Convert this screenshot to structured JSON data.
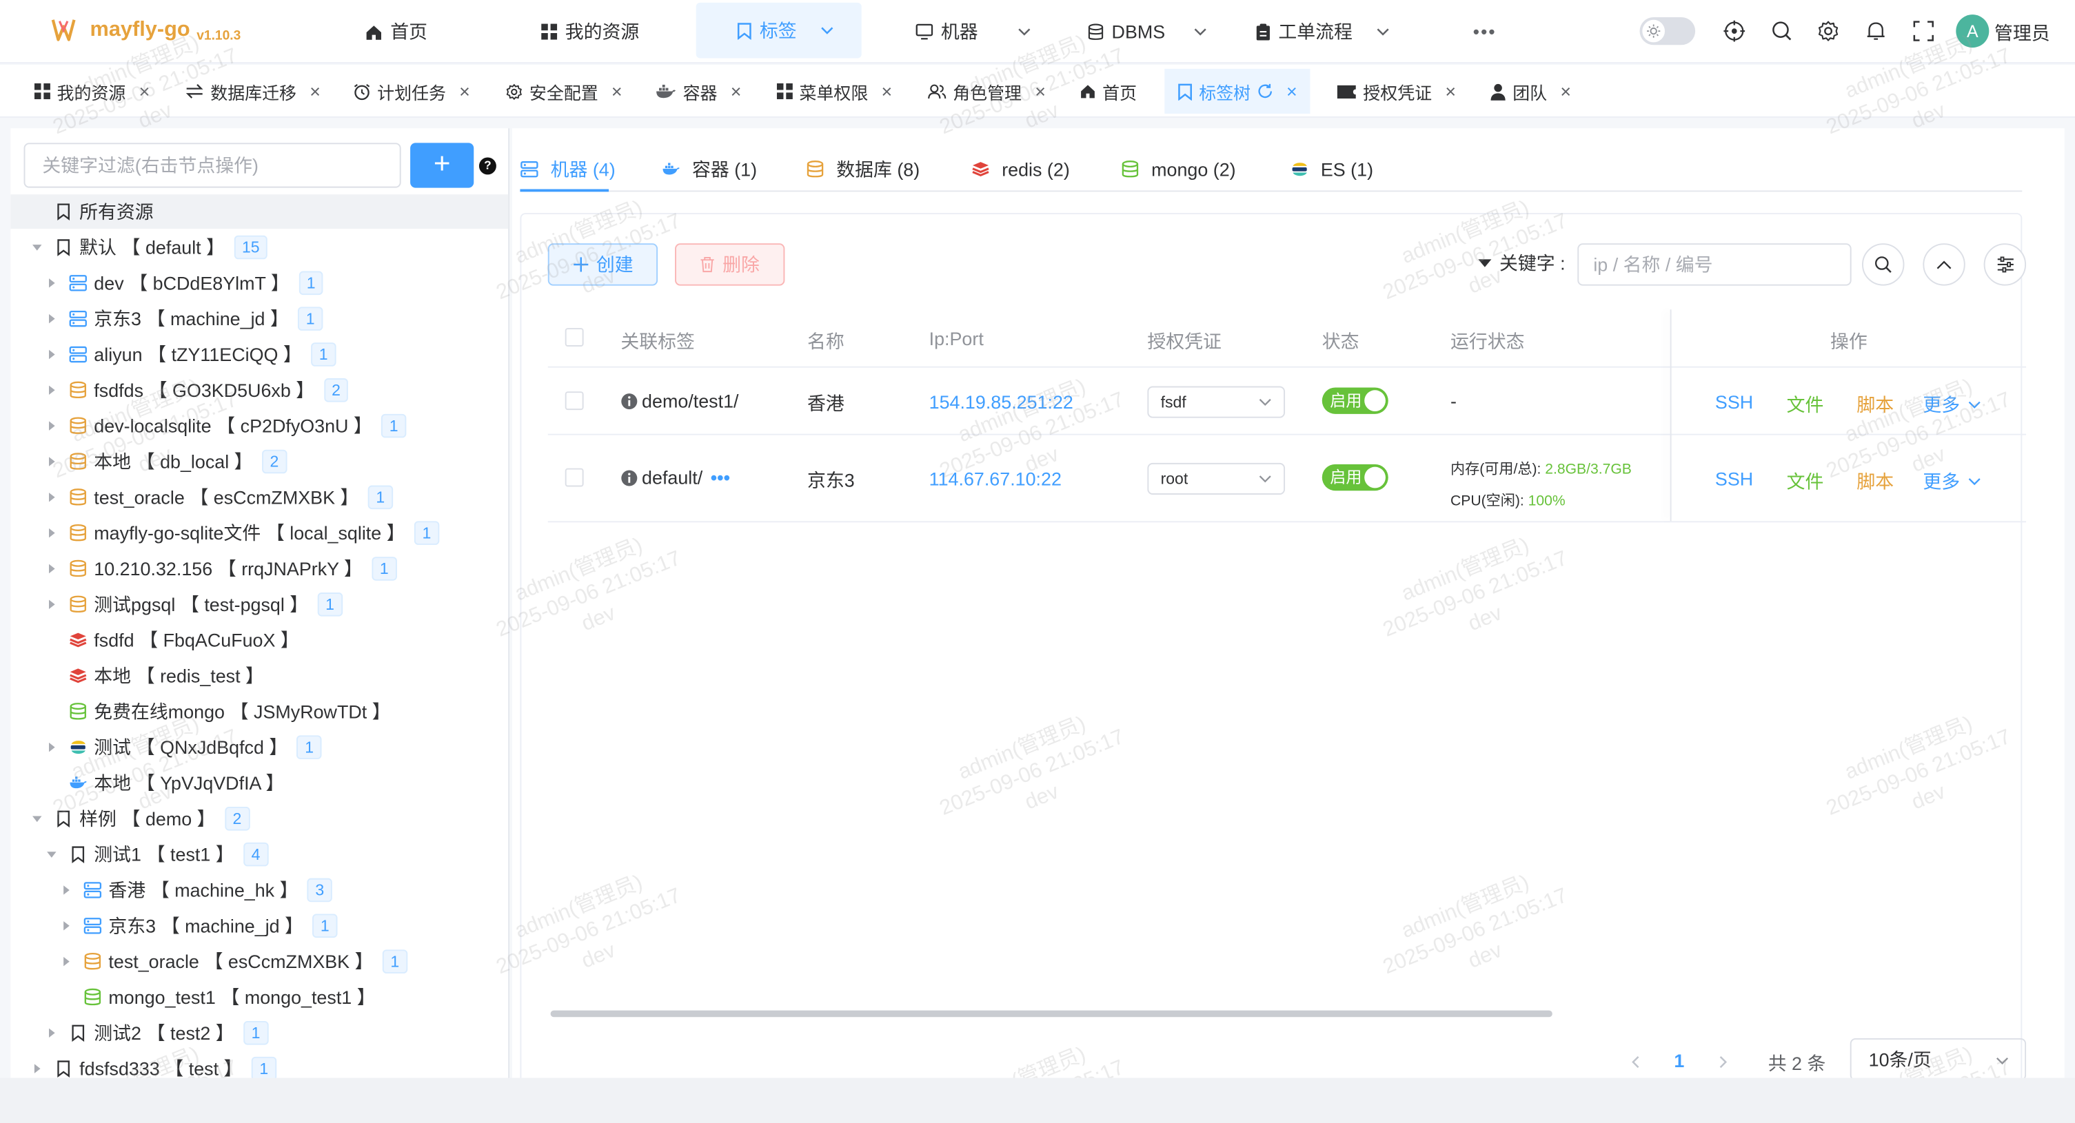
{
  "app": {
    "name": "mayfly-go",
    "version": "v1.10.3"
  },
  "header": {
    "nav": [
      {
        "label": "首页",
        "icon": "home-icon"
      },
      {
        "label": "我的资源",
        "icon": "grid-icon"
      },
      {
        "label": "标签",
        "icon": "bookmark-icon",
        "active": true
      },
      {
        "label": "机器",
        "icon": "monitor-icon"
      },
      {
        "label": "DBMS",
        "icon": "database-icon"
      },
      {
        "label": "工单流程",
        "icon": "clipboard-icon"
      }
    ],
    "more": "•••",
    "user": {
      "initial": "A",
      "name": "管理员"
    }
  },
  "tabs": [
    {
      "label": "我的资源",
      "icon": "grid-icon"
    },
    {
      "label": "数据库迁移",
      "icon": "swap-icon"
    },
    {
      "label": "计划任务",
      "icon": "alarm-icon"
    },
    {
      "label": "安全配置",
      "icon": "gear-icon"
    },
    {
      "label": "容器",
      "icon": "docker-icon"
    },
    {
      "label": "菜单权限",
      "icon": "grid-icon"
    },
    {
      "label": "角色管理",
      "icon": "users-icon"
    },
    {
      "label": "首页",
      "icon": "home-icon"
    },
    {
      "label": "标签树",
      "icon": "bookmark-icon",
      "active": true
    },
    {
      "label": "授权凭证",
      "icon": "ticket-icon"
    },
    {
      "label": "团队",
      "icon": "user-icon"
    }
  ],
  "tree": {
    "search_placeholder": "关键字过滤(右击节点操作)",
    "add_label": "+",
    "help_label": "?",
    "root": "所有资源",
    "nodes": [
      {
        "name": "默认",
        "code": "【 default 】",
        "count": "15",
        "icon": "tag",
        "level": 0,
        "caret": "down"
      },
      {
        "name": "dev",
        "code": "【 bCDdE8YlmT 】",
        "count": "1",
        "icon": "machine",
        "level": 1,
        "caret": "right"
      },
      {
        "name": "京东3",
        "code": "【 machine_jd 】",
        "count": "1",
        "icon": "machine",
        "level": 1,
        "caret": "right"
      },
      {
        "name": "aliyun",
        "code": "【 tZY11ECiQQ 】",
        "count": "1",
        "icon": "machine",
        "level": 1,
        "caret": "right"
      },
      {
        "name": "fsdfds",
        "code": "【 GO3KD5U6xb 】",
        "count": "2",
        "icon": "db",
        "level": 1,
        "caret": "right"
      },
      {
        "name": "dev-localsqlite",
        "code": "【 cP2DfyO3nU 】",
        "count": "1",
        "icon": "db",
        "level": 1,
        "caret": "right"
      },
      {
        "name": "本地",
        "code": "【 db_local 】",
        "count": "2",
        "icon": "db",
        "level": 1,
        "caret": "right"
      },
      {
        "name": "test_oracle",
        "code": "【 esCcmZMXBK 】",
        "count": "1",
        "icon": "db",
        "level": 1,
        "caret": "right"
      },
      {
        "name": "mayfly-go-sqlite文件",
        "code": "【 local_sqlite 】",
        "count": "1",
        "icon": "db",
        "level": 1,
        "caret": "right"
      },
      {
        "name": "10.210.32.156",
        "code": "【 rrqJNAPrkY 】",
        "count": "1",
        "icon": "db",
        "level": 1,
        "caret": "right"
      },
      {
        "name": "测试pgsql",
        "code": "【 test-pgsql 】",
        "count": "1",
        "icon": "db",
        "level": 1,
        "caret": "right"
      },
      {
        "name": "fsdfd",
        "code": "【 FbqACuFuoX 】",
        "count": "",
        "icon": "redis",
        "level": 1,
        "caret": ""
      },
      {
        "name": "本地",
        "code": "【 redis_test 】",
        "count": "",
        "icon": "redis",
        "level": 1,
        "caret": ""
      },
      {
        "name": "免费在线mongo",
        "code": "【 JSMyRowTDt 】",
        "count": "",
        "icon": "mongo",
        "level": 1,
        "caret": ""
      },
      {
        "name": "测试",
        "code": "【 QNxJdBqfcd 】",
        "count": "1",
        "icon": "es",
        "level": 1,
        "caret": "right"
      },
      {
        "name": "本地",
        "code": "【 YpVJqVDfIA 】",
        "count": "",
        "icon": "docker",
        "level": 1,
        "caret": ""
      },
      {
        "name": "样例",
        "code": "【 demo 】",
        "count": "2",
        "icon": "tag",
        "level": 0,
        "caret": "down"
      },
      {
        "name": "测试1",
        "code": "【 test1 】",
        "count": "4",
        "icon": "tag",
        "level": 1,
        "caret": "down"
      },
      {
        "name": "香港",
        "code": "【 machine_hk 】",
        "count": "3",
        "icon": "machine",
        "level": 2,
        "caret": "right"
      },
      {
        "name": "京东3",
        "code": "【 machine_jd 】",
        "count": "1",
        "icon": "machine",
        "level": 2,
        "caret": "right"
      },
      {
        "name": "test_oracle",
        "code": "【 esCcmZMXBK 】",
        "count": "1",
        "icon": "db",
        "level": 2,
        "caret": "right"
      },
      {
        "name": "mongo_test1",
        "code": "【 mongo_test1 】",
        "count": "",
        "icon": "mongo",
        "level": 2,
        "caret": ""
      },
      {
        "name": "测试2",
        "code": "【 test2 】",
        "count": "1",
        "icon": "tag",
        "level": 1,
        "caret": "right"
      },
      {
        "name": "fdsfsd333",
        "code": "【 test 】",
        "count": "1",
        "icon": "tag",
        "level": 0,
        "caret": "right"
      }
    ]
  },
  "resource_tabs": [
    {
      "label": "机器 (4)",
      "icon": "machine",
      "active": true
    },
    {
      "label": "容器 (1)",
      "icon": "docker"
    },
    {
      "label": "数据库 (8)",
      "icon": "db"
    },
    {
      "label": "redis (2)",
      "icon": "redis"
    },
    {
      "label": "mongo (2)",
      "icon": "mongo"
    },
    {
      "label": "ES (1)",
      "icon": "es"
    }
  ],
  "toolbar": {
    "create": "创建",
    "delete": "删除",
    "keyword_label": "关键字 :",
    "keyword_placeholder": "ip / 名称 / 编号"
  },
  "table": {
    "columns": [
      "关联标签",
      "名称",
      "Ip:Port",
      "授权凭证",
      "状态",
      "运行状态",
      "操作"
    ],
    "rows": [
      {
        "tag": "demo/test1/",
        "tag_more": "",
        "name": "香港",
        "ip": "154.19.85.251:22",
        "auth": "fsdf",
        "status": "启用",
        "run": "-",
        "mem_label": "",
        "mem": "",
        "cpu_label": "",
        "cpu": ""
      },
      {
        "tag": "default/",
        "tag_more": "•••",
        "name": "京东3",
        "ip": "114.67.67.10:22",
        "auth": "root",
        "status": "启用",
        "run": "",
        "mem_label": "内存(可用/总):",
        "mem": "2.8GB/3.7GB",
        "cpu_label": "CPU(空闲):",
        "cpu": "100%"
      }
    ],
    "ops": {
      "ssh": "SSH",
      "file": "文件",
      "script": "脚本",
      "more": "更多"
    }
  },
  "pagination": {
    "current": "1",
    "total": "共 2 条",
    "size": "10条/页"
  },
  "watermark": {
    "user": "admin(管理员)",
    "time": "2025-09-06 21:05:17",
    "env": "dev"
  },
  "colors": {
    "primary": "#409eff",
    "success": "#67c23a",
    "warning": "#e6a23c",
    "danger": "#f56c6c",
    "redis": "#e0443b"
  }
}
